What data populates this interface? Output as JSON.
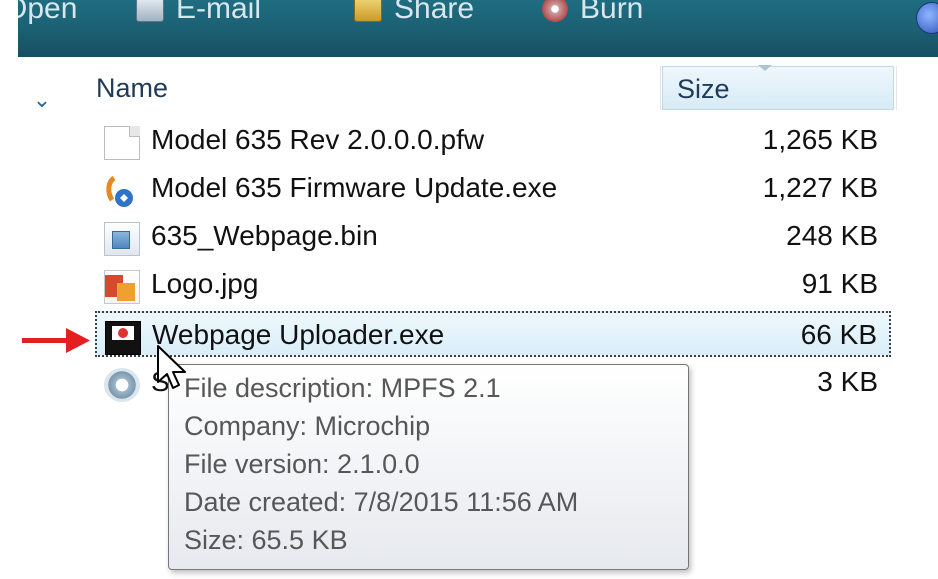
{
  "toolbar": {
    "items": [
      {
        "label": "Open"
      },
      {
        "label": "E-mail",
        "icon": "email-icon"
      },
      {
        "label": "Share",
        "icon": "share-icon"
      },
      {
        "label": "Burn",
        "icon": "burn-icon"
      }
    ]
  },
  "columns": {
    "name": "Name",
    "size": "Size"
  },
  "files": [
    {
      "name": "Model 635 Rev 2.0.0.0.pfw",
      "size": "1,265 KB",
      "icon": "document-icon"
    },
    {
      "name": "Model 635 Firmware Update.exe",
      "size": "1,227 KB",
      "icon": "installer-icon"
    },
    {
      "name": "635_Webpage.bin",
      "size": "248 KB",
      "icon": "binary-file-icon"
    },
    {
      "name": "Logo.jpg",
      "size": "91 KB",
      "icon": "image-file-icon"
    },
    {
      "name": "Webpage Uploader.exe",
      "size": "66 KB",
      "icon": "floppy-disk-icon",
      "selected": true
    },
    {
      "name": "S",
      "size": "3 KB",
      "icon": "gear-file-icon"
    }
  ],
  "tooltip": {
    "line1": "File description: MPFS 2.1",
    "line2": "Company: Microchip",
    "line3": "File version: 2.1.0.0",
    "line4": "Date created: 7/8/2015 11:56 AM",
    "line5": "Size: 65.5 KB"
  },
  "colors": {
    "toolbar": "#1b5f72",
    "selection": "#d9eefa",
    "arrow": "#e41f1f",
    "tooltip_text": "#575757"
  }
}
